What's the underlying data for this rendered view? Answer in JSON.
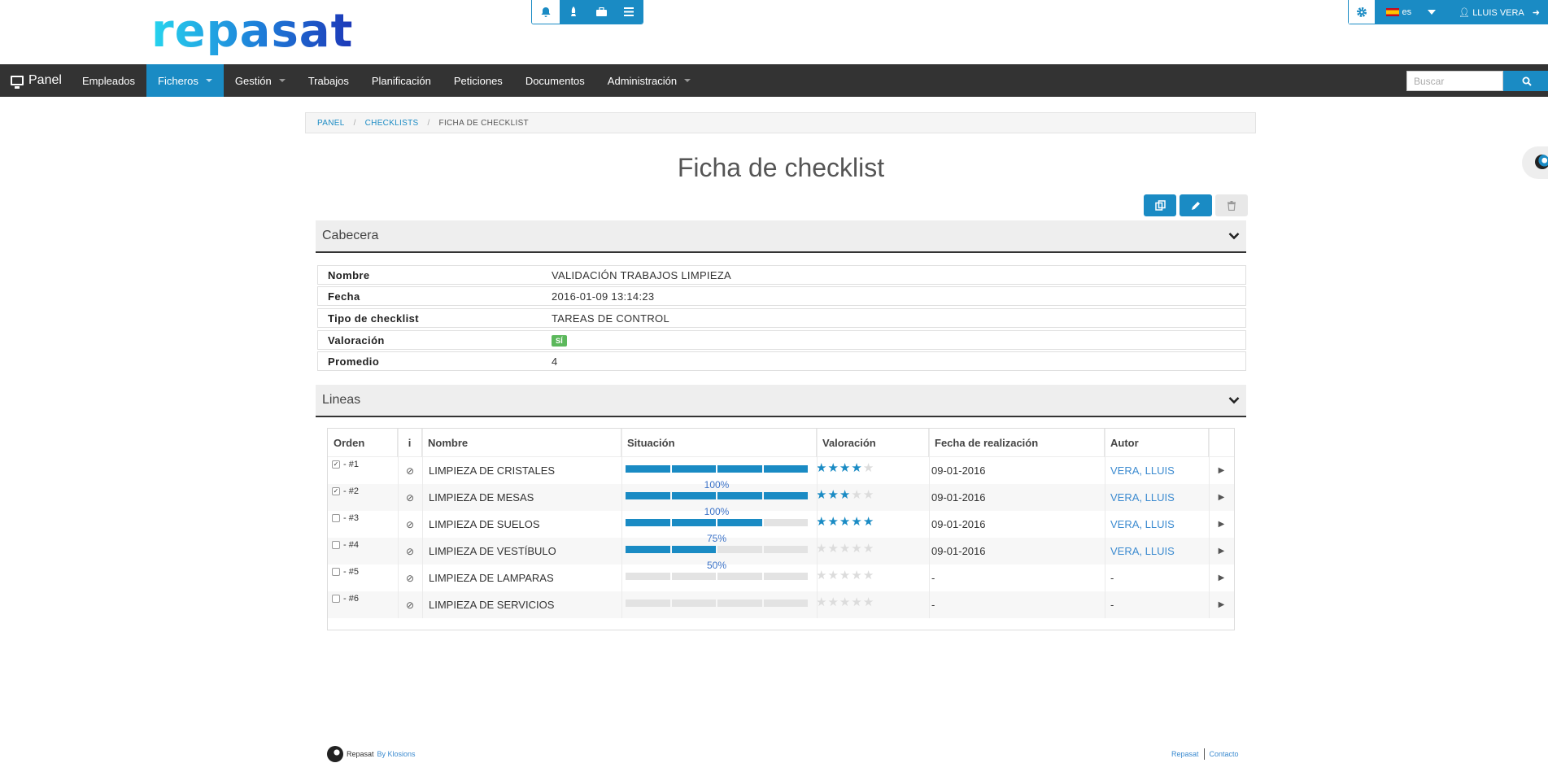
{
  "header": {
    "logo_text": "repasat",
    "language": "es",
    "user_name": "LLUIS VERA",
    "icons": [
      "bell-icon",
      "rocket-icon",
      "briefcase-icon",
      "list-icon",
      "gear-icon",
      "user-icon",
      "logout-icon"
    ]
  },
  "navbar": {
    "brand": "Panel",
    "items": [
      {
        "label": "Empleados",
        "has_caret": false,
        "active": false
      },
      {
        "label": "Ficheros",
        "has_caret": true,
        "active": true
      },
      {
        "label": "Gestión",
        "has_caret": true,
        "active": false
      },
      {
        "label": "Trabajos",
        "has_caret": false,
        "active": false
      },
      {
        "label": "Planificación",
        "has_caret": false,
        "active": false
      },
      {
        "label": "Peticiones",
        "has_caret": false,
        "active": false
      },
      {
        "label": "Documentos",
        "has_caret": false,
        "active": false
      },
      {
        "label": "Administración",
        "has_caret": true,
        "active": false
      }
    ],
    "search_placeholder": "Buscar"
  },
  "breadcrumb": {
    "items": [
      "PANEL",
      "CHECKLISTS"
    ],
    "current": "FICHA DE CHECKLIST"
  },
  "page": {
    "title": "Ficha de checklist"
  },
  "cabecera": {
    "title": "Cabecera",
    "fields": [
      {
        "label": "Nombre",
        "value": "VALIDACIÓN TRABAJOS LIMPIEZA"
      },
      {
        "label": "Fecha",
        "value": "2016-01-09 13:14:23"
      },
      {
        "label": "Tipo de checklist",
        "value": "TAREAS DE CONTROL"
      },
      {
        "label": "Valoración",
        "value": "SÍ"
      },
      {
        "label": "Promedio",
        "value": "4"
      }
    ]
  },
  "lineas": {
    "title": "Lineas",
    "columns": [
      "Orden",
      "i",
      "Nombre",
      "Situación",
      "Valoración",
      "Fecha de realización",
      "Autor"
    ],
    "rows": [
      {
        "checked": true,
        "orden": "- #1",
        "nombre": "LIMPIEZA DE CRISTALES",
        "progress_segments": 4,
        "progress_label": "",
        "stars": 4,
        "fecha": "09-01-2016",
        "autor": "VERA, LLUIS"
      },
      {
        "checked": true,
        "orden": "- #2",
        "nombre": "LIMPIEZA DE MESAS",
        "progress_segments": 4,
        "progress_label": "100%",
        "stars": 3,
        "fecha": "09-01-2016",
        "autor": "VERA, LLUIS"
      },
      {
        "checked": false,
        "orden": "- #3",
        "nombre": "LIMPIEZA DE SUELOS",
        "progress_segments": 3,
        "progress_label": "100%",
        "stars": 5,
        "fecha": "09-01-2016",
        "autor": "VERA, LLUIS"
      },
      {
        "checked": false,
        "orden": "- #4",
        "nombre": "LIMPIEZA DE VESTÍBULO",
        "progress_segments": 2,
        "progress_label": "75%",
        "stars": 0,
        "fecha": "09-01-2016",
        "autor": "VERA, LLUIS"
      },
      {
        "checked": false,
        "orden": "- #5",
        "nombre": "LIMPIEZA DE LAMPARAS",
        "progress_segments": 0,
        "progress_label": "50%",
        "stars": 0,
        "fecha": "-",
        "autor": "-"
      },
      {
        "checked": false,
        "orden": "- #6",
        "nombre": "LIMPIEZA DE SERVICIOS",
        "progress_segments": 0,
        "progress_label": "",
        "stars": 0,
        "fecha": "-",
        "autor": "-"
      }
    ]
  },
  "footer": {
    "brand": "Repasat",
    "by": "By Klosions",
    "links": [
      "Repasat",
      "Contacto"
    ]
  },
  "colors": {
    "accent": "#1a8bc4",
    "navbar": "#333333",
    "success": "#5cb85c",
    "link": "#3c8bd0"
  }
}
